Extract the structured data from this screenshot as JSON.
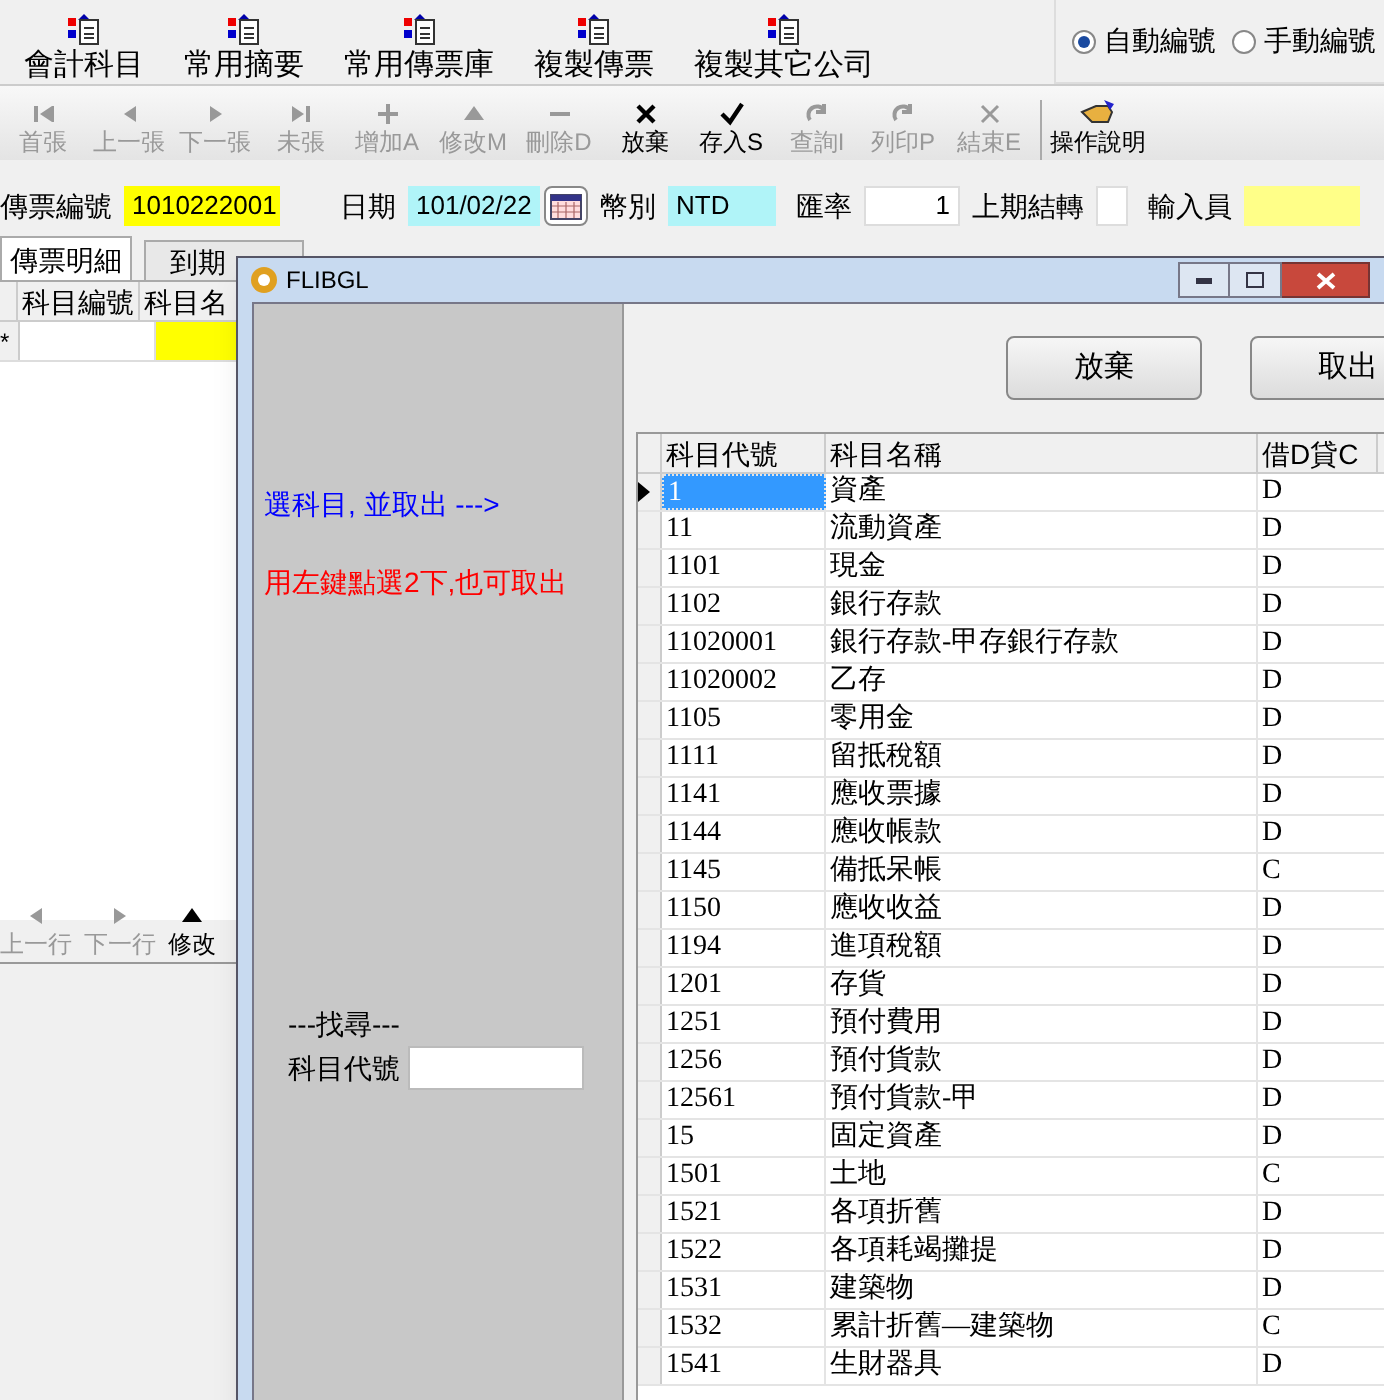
{
  "top_toolbar": [
    "會計科目",
    "常用摘要",
    "常用傳票庫",
    "複製傳票",
    "複製其它公司"
  ],
  "numbering": [
    {
      "label": "自動編號",
      "selected": true
    },
    {
      "label": "手動編號",
      "selected": false
    }
  ],
  "nav_toolbar": [
    {
      "label": "首張",
      "disabled": true
    },
    {
      "label": "上一張",
      "disabled": true
    },
    {
      "label": "下一張",
      "disabled": true
    },
    {
      "label": "未張",
      "disabled": true
    },
    {
      "label": "增加A",
      "disabled": true
    },
    {
      "label": "修改M",
      "disabled": true
    },
    {
      "label": "刪除D",
      "disabled": true
    },
    {
      "label": "放棄",
      "disabled": false
    },
    {
      "label": "存入S",
      "disabled": false
    },
    {
      "label": "查詢I",
      "disabled": true
    },
    {
      "label": "列印P",
      "disabled": true
    },
    {
      "label": "結束E",
      "disabled": true
    },
    {
      "label": "操作說明",
      "disabled": false
    }
  ],
  "form": {
    "voucher_no_label": "傳票編號",
    "voucher_no": "1010222001",
    "date_label": "日期",
    "date": "101/02/22",
    "currency_label": "幣別",
    "currency": "NTD",
    "rate_label": "匯率",
    "rate": "1",
    "carry_label": "上期結轉",
    "entered_by_label": "輸入員"
  },
  "tabs": [
    {
      "label": "傳票明細",
      "selected": true
    },
    {
      "label": "到期",
      "selected": false
    }
  ],
  "detail_grid": {
    "columns": [
      "科目編號",
      "科目名"
    ],
    "new_row_marker": "*"
  },
  "row_buttons": [
    {
      "label": "上一行",
      "disabled": true
    },
    {
      "label": "下一行",
      "disabled": true
    },
    {
      "label": "修改",
      "disabled": false
    }
  ],
  "dialog": {
    "title": "FLIBGL",
    "hint_select": "選科目, 並取出 --->",
    "hint_double_click": "用左鍵點選2下,也可取出",
    "search_title": "---找尋---",
    "search_label": "科目代號",
    "buttons": [
      "放棄",
      "取出"
    ],
    "columns": [
      "科目代號",
      "科目名稱",
      "借D貸C"
    ],
    "rows": [
      {
        "code": "1",
        "name": "資產",
        "dc": "D",
        "selected": true
      },
      {
        "code": "11",
        "name": "流動資產",
        "dc": "D",
        "selected": false
      },
      {
        "code": "1101",
        "name": "現金",
        "dc": "D",
        "selected": false
      },
      {
        "code": "1102",
        "name": "銀行存款",
        "dc": "D",
        "selected": false
      },
      {
        "code": "11020001",
        "name": "銀行存款-甲存銀行存款",
        "dc": "D",
        "selected": false
      },
      {
        "code": "11020002",
        "name": "乙存",
        "dc": "D",
        "selected": false
      },
      {
        "code": "1105",
        "name": "零用金",
        "dc": "D",
        "selected": false
      },
      {
        "code": "1111",
        "name": "留抵稅額",
        "dc": "D",
        "selected": false
      },
      {
        "code": "1141",
        "name": "應收票據",
        "dc": "D",
        "selected": false
      },
      {
        "code": "1144",
        "name": "應收帳款",
        "dc": "D",
        "selected": false
      },
      {
        "code": "1145",
        "name": "備抵呆帳",
        "dc": "C",
        "selected": false
      },
      {
        "code": "1150",
        "name": "應收收益",
        "dc": "D",
        "selected": false
      },
      {
        "code": "1194",
        "name": "進項稅額",
        "dc": "D",
        "selected": false
      },
      {
        "code": "1201",
        "name": "存貨",
        "dc": "D",
        "selected": false
      },
      {
        "code": "1251",
        "name": "預付費用",
        "dc": "D",
        "selected": false
      },
      {
        "code": "1256",
        "name": "預付貨款",
        "dc": "D",
        "selected": false
      },
      {
        "code": "12561",
        "name": "預付貨款-甲",
        "dc": "D",
        "selected": false
      },
      {
        "code": "15",
        "name": "固定資產",
        "dc": "D",
        "selected": false
      },
      {
        "code": "1501",
        "name": "土地",
        "dc": "C",
        "selected": false
      },
      {
        "code": "1521",
        "name": "各項折舊",
        "dc": "D",
        "selected": false
      },
      {
        "code": "1522",
        "name": "各項耗竭攤提",
        "dc": "D",
        "selected": false
      },
      {
        "code": "1531",
        "name": "建築物",
        "dc": "D",
        "selected": false
      },
      {
        "code": "1532",
        "name": "累計折舊—建築物",
        "dc": "C",
        "selected": false
      },
      {
        "code": "1541",
        "name": "生財器具",
        "dc": "D",
        "selected": false
      }
    ]
  }
}
